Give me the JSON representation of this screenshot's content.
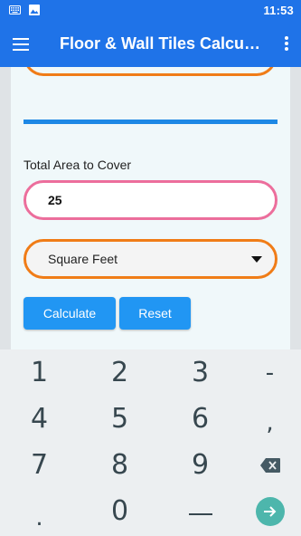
{
  "status_bar": {
    "time": "11:53",
    "icons": [
      "keyboard-icon",
      "image-icon"
    ]
  },
  "app_bar": {
    "title": "Floor & Wall Tiles Calculator",
    "menu_icon": "menu-icon",
    "overflow_icon": "more-vert-icon"
  },
  "form": {
    "area_label": "Total Area to Cover",
    "area_value": "25",
    "unit_selected": "Square Feet",
    "calculate_label": "Calculate",
    "reset_label": "Reset"
  },
  "colors": {
    "primary": "#1f73e8",
    "accent_blue": "#2196f3",
    "input_border_pink": "#ec6e9c",
    "select_border_orange": "#f07c17",
    "enter_key": "#4db6ac"
  },
  "keyboard": {
    "rows": [
      [
        "1",
        "2",
        "3",
        "-"
      ],
      [
        "4",
        "5",
        "6",
        ","
      ],
      [
        "7",
        "8",
        "9",
        "backspace-icon"
      ],
      [
        ".",
        "0",
        "space-icon",
        "enter-icon"
      ]
    ]
  }
}
